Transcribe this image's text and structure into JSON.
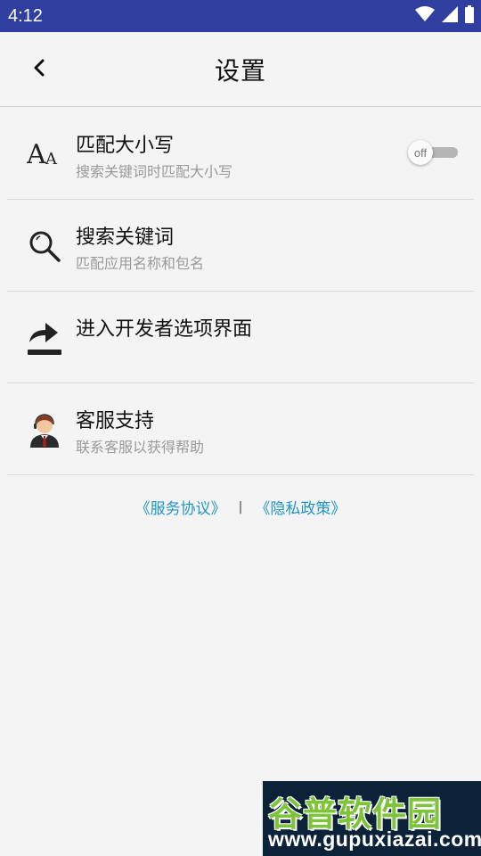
{
  "status_bar": {
    "time": "4:12",
    "icons": [
      "wifi-icon",
      "signal-icon",
      "battery-icon"
    ],
    "background": "#303f9f"
  },
  "header": {
    "title": "设置",
    "back_icon": "chevron-left-icon"
  },
  "settings": [
    {
      "icon": "font-size-icon",
      "label": "匹配大小写",
      "subtitle": "搜索关键词时匹配大小写",
      "toggle": {
        "label": "off",
        "state": false
      }
    },
    {
      "icon": "search-icon",
      "label": "搜索关键词",
      "subtitle": "匹配应用名称和包名"
    },
    {
      "icon": "share-forward-icon",
      "label": "进入开发者选项界面",
      "subtitle": ""
    },
    {
      "icon": "customer-service-avatar-icon",
      "label": "客服支持",
      "subtitle": "联系客服以获得帮助"
    }
  ],
  "footer": {
    "terms_link": "《服务协议》",
    "separator": "|",
    "privacy_link": "《隐私政策》",
    "link_color": "#2196c4"
  },
  "watermark": {
    "title": "谷普软件园",
    "url": "www.gupuxiazai.com"
  }
}
